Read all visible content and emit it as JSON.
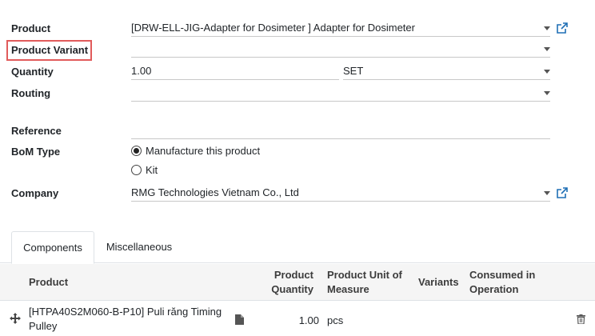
{
  "form": {
    "product_label": "Product",
    "product_value": "[DRW-ELL-JIG-Adapter for Dosimeter ] Adapter for Dosimeter",
    "variant_label": "Product Variant",
    "variant_value": "",
    "quantity_label": "Quantity",
    "quantity_value": "1.00",
    "uom_value": "SET",
    "routing_label": "Routing",
    "routing_value": "",
    "reference_label": "Reference",
    "reference_value": "",
    "bomtype_label": "BoM Type",
    "bomtype_option1": "Manufacture this product",
    "bomtype_option2": "Kit",
    "company_label": "Company",
    "company_value": "RMG Technologies Vietnam Co., Ltd"
  },
  "tabs": {
    "components": "Components",
    "misc": "Miscellaneous"
  },
  "table": {
    "headers": {
      "product": "Product",
      "qty_line1": "Product",
      "qty_line2": "Quantity",
      "uom_line1": "Product Unit of",
      "uom_line2": "Measure",
      "variants": "Variants",
      "consumed_line1": "Consumed in",
      "consumed_line2": "Operation"
    },
    "rows": [
      {
        "product_line1": "[HTPA40S2M060-B-P10] Puli răng Timing",
        "product_line2": "Pulley",
        "quantity": "1.00",
        "uom": "pcs"
      }
    ]
  },
  "colors": {
    "highlight": "#e15b5b",
    "link_icon": "#1f6fb5"
  }
}
